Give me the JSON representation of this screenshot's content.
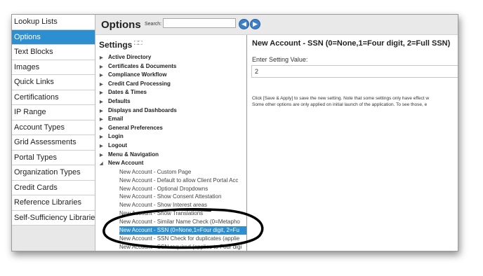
{
  "left_nav": {
    "items": [
      {
        "label": "Lookup Lists",
        "active": false
      },
      {
        "label": "Options",
        "active": true
      },
      {
        "label": "Text Blocks",
        "active": false
      },
      {
        "label": "Images",
        "active": false
      },
      {
        "label": "Quick Links",
        "active": false
      },
      {
        "label": "Certifications",
        "active": false
      },
      {
        "label": "IP Range",
        "active": false
      },
      {
        "label": "Account Types",
        "active": false
      },
      {
        "label": "Grid Assessments",
        "active": false
      },
      {
        "label": "Portal Types",
        "active": false
      },
      {
        "label": "Organization Types",
        "active": false
      },
      {
        "label": "Credit Cards",
        "active": false
      },
      {
        "label": "Reference Libraries",
        "active": false
      },
      {
        "label": "Self-Sufficiency Libraries",
        "active": false
      }
    ]
  },
  "header": {
    "title": "Options",
    "search_label": "Search:",
    "search_value": ""
  },
  "settings": {
    "heading": "Settings",
    "expand_icon": "expand-collapse-icon",
    "categories": [
      "Active Directory",
      "Certificates & Documents",
      "Compliance Workflow",
      "Credit Card Processing",
      "Dates & Times",
      "Defaults",
      "Displays and Dashboards",
      "Email",
      "General Preferences",
      "Login",
      "Logout",
      "Menu & Navigation",
      "New Account"
    ],
    "children": [
      "New Account - Custom Page",
      "New Account - Default to allow Client Portal Acc",
      "New Account - Optional Dropdowns",
      "New Account - Show Consent Attestation",
      "New Account - Show Interest areas",
      "New Account - Show Translations",
      "New Account - Similar Name Check (0=Metapho",
      "New Account - SSN (0=None,1=Four digit, 2=Fu",
      "New Account - SSN Check for duplicates (applie",
      "New Account - SSN required (applies to Four digi"
    ],
    "selected_child_index": 7
  },
  "detail": {
    "title": "New Account - SSN (0=None,1=Four digit, 2=Full SSN)",
    "enter_label": "Enter Setting Value:",
    "value": "2",
    "help_line1": "Click [Save & Apply] to save the new setting. Note that some settings only have effect w",
    "help_line2": "Some other options are only applied on initial launch of the application. To see those, e"
  },
  "colors": {
    "accent": "#2e8fd0",
    "annotation": "#000000"
  }
}
